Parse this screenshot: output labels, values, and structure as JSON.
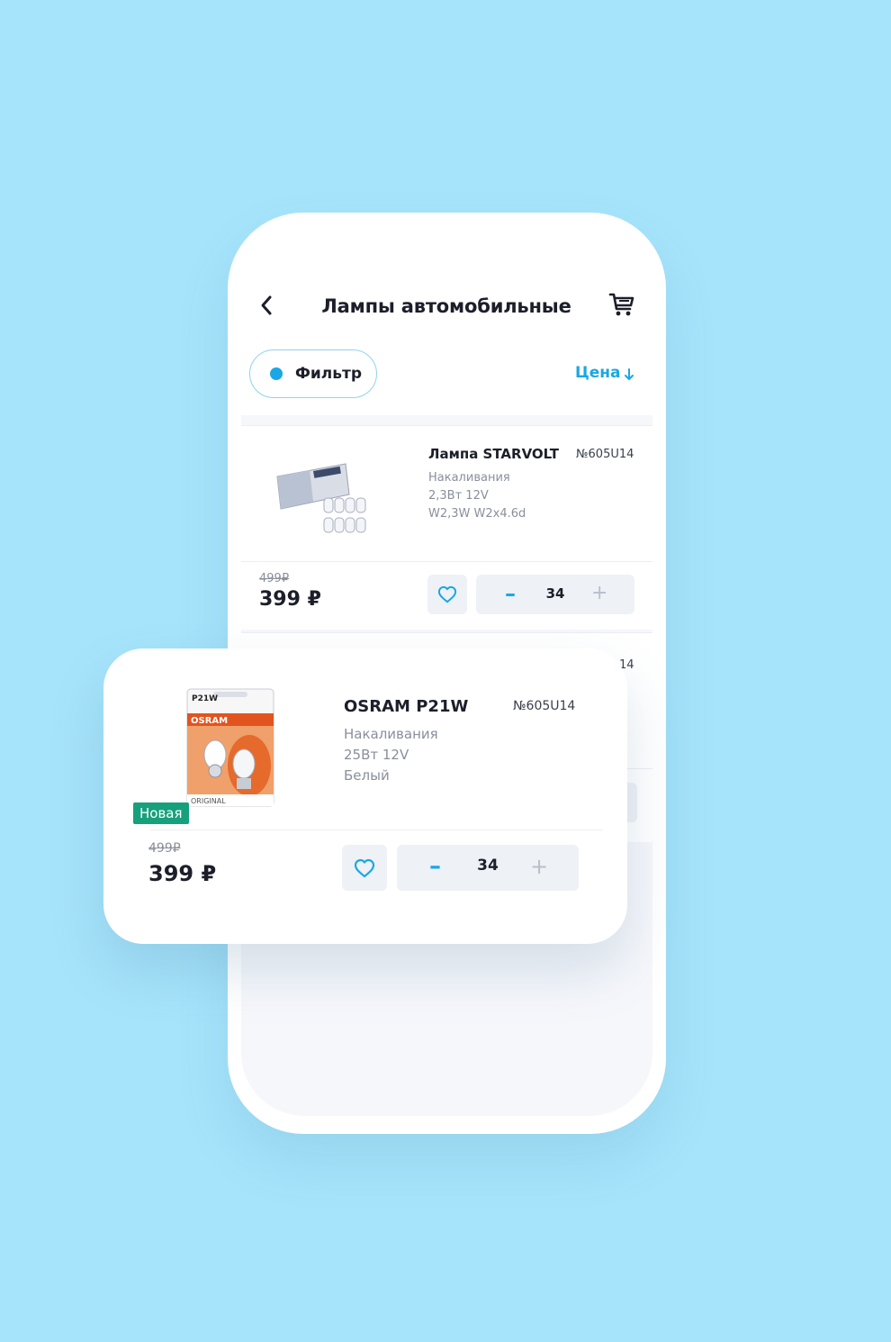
{
  "header": {
    "title": "Лампы автомобильные",
    "back_icon": "chevron-left-icon",
    "cart_icon": "cart-icon"
  },
  "toolbar": {
    "filter_label": "Фильтр",
    "sort_label": "Цена",
    "sort_icon": "arrow-down-icon"
  },
  "products": [
    {
      "name": "Лампа STARVOLT",
      "sku": "№605U14",
      "desc": [
        "Накаливания",
        "2,3Вт 12V",
        "W2,3W W2x4.6d"
      ],
      "old_price": "499₽",
      "price": "399 ₽",
      "qty": "34",
      "minus": "–",
      "plus": "+"
    },
    {
      "sku_partial": "14"
    }
  ],
  "popup": {
    "badge": "Новая",
    "name": "OSRAM P21W",
    "sku": "№605U14",
    "desc": [
      "Накаливания",
      "25Вт 12V",
      "Белый"
    ],
    "old_price": "499₽",
    "price": "399 ₽",
    "qty": "34",
    "minus": "–",
    "plus": "+"
  },
  "colors": {
    "background": "#a6e4fb",
    "accent": "#1aa7e6",
    "badge": "#17a07c"
  }
}
